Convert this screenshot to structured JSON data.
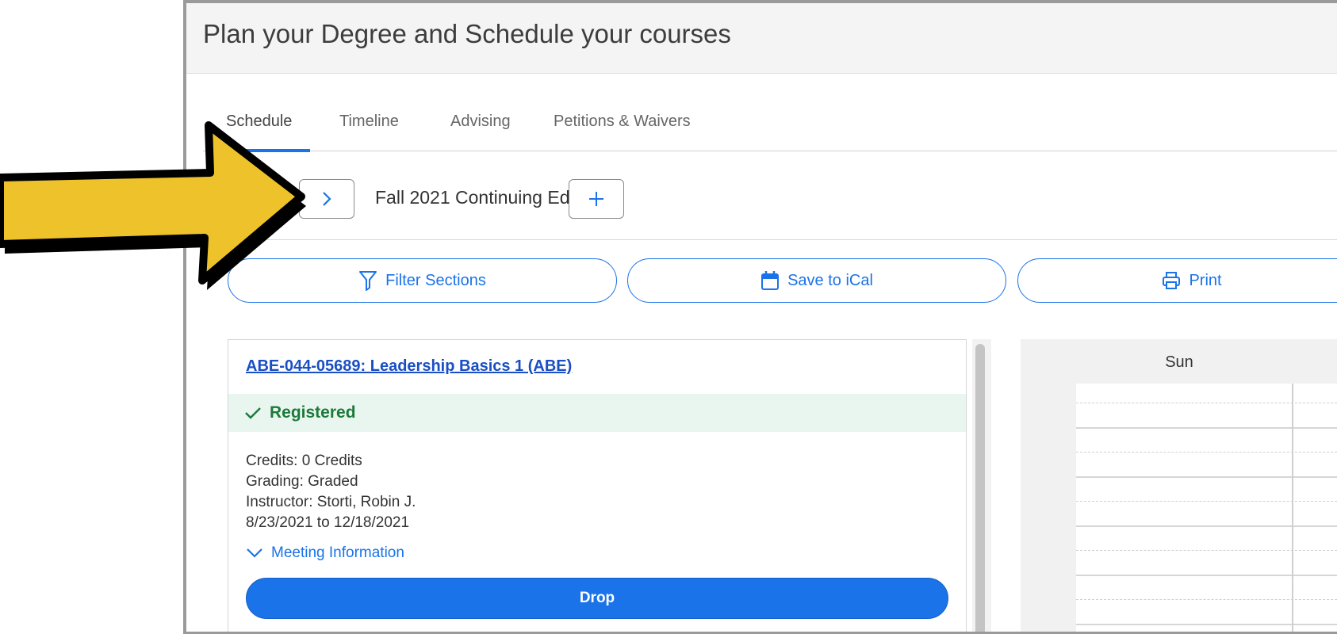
{
  "page": {
    "title": "Plan your Degree and Schedule your courses"
  },
  "tabs": [
    {
      "label": "Schedule",
      "active": true
    },
    {
      "label": "Timeline",
      "active": false
    },
    {
      "label": "Advising",
      "active": false
    },
    {
      "label": "Petitions & Waivers",
      "active": false
    }
  ],
  "term": {
    "label": "Fall 2021 Continuing Ed."
  },
  "actions": {
    "filter_label": "Filter Sections",
    "ical_label": "Save to iCal",
    "print_label": "Print"
  },
  "course": {
    "title": "ABE-044-05689: Leadership Basics 1 (ABE)",
    "status": "Registered",
    "credits": "Credits: 0 Credits",
    "grading": "Grading: Graded",
    "instructor": "Instructor: Storti, Robin J.",
    "dates": "8/23/2021 to 12/18/2021",
    "meeting_label": "Meeting Information",
    "drop_label": "Drop"
  },
  "calendar": {
    "day_label": "Sun"
  },
  "colors": {
    "accent": "#1a73e8",
    "registered": "#1d7a3a",
    "registered_bg": "#e9f6ef",
    "arrow_fill": "#eec22a"
  },
  "icons": {
    "next": "chevron-right-icon",
    "add": "plus-icon",
    "filter": "filter-icon",
    "calendar": "calendar-icon",
    "print": "printer-icon",
    "registered": "checkmark-icon",
    "meeting": "chevron-down-icon"
  }
}
